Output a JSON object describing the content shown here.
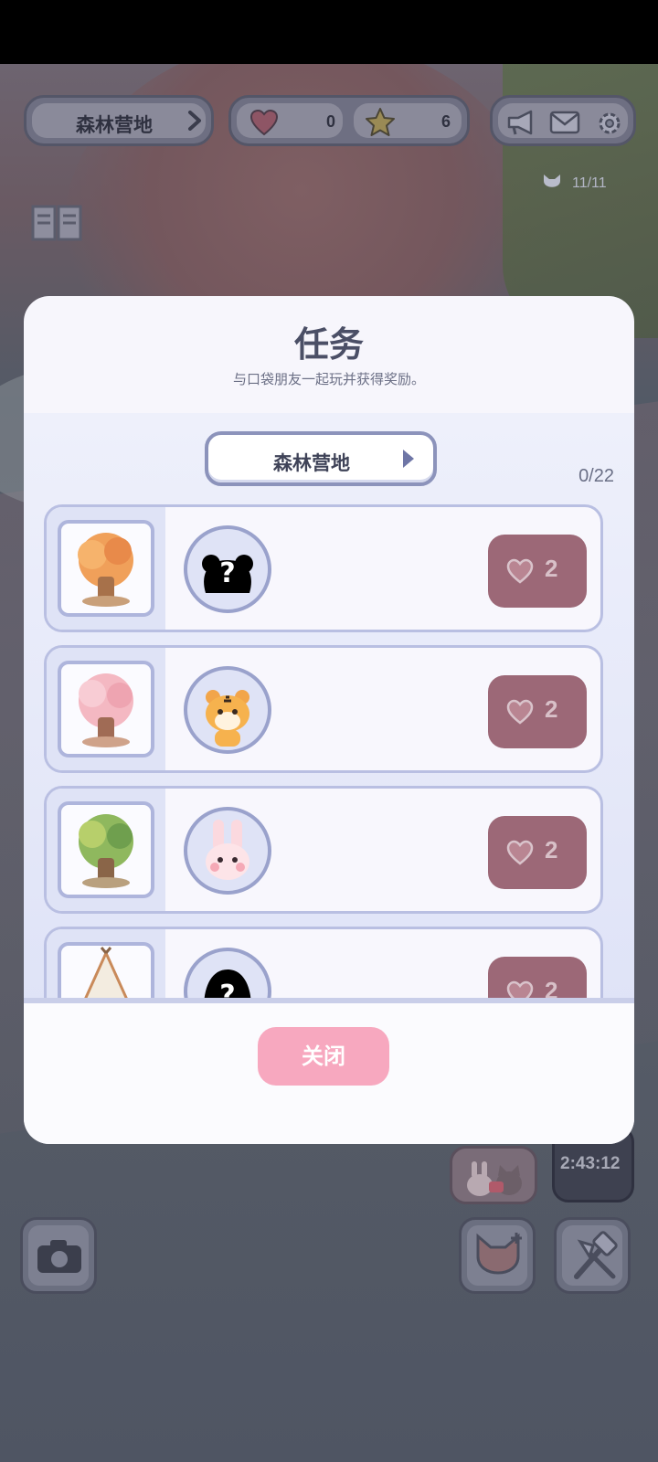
{
  "header": {
    "area_name": "森林营地",
    "hearts": "0",
    "stars": "6",
    "cat_capacity": "11/11"
  },
  "scene": {
    "timer": "2:43:12"
  },
  "dialog": {
    "title": "任务",
    "subtitle": "与口袋朋友一起玩并获得奖励。",
    "area_selector": "森林营地",
    "progress": "0/22",
    "tasks": [
      {
        "item": "autumn-tree",
        "friend": "unknown",
        "reward": "2"
      },
      {
        "item": "cherry-blossom-tree",
        "friend": "tiger",
        "reward": "2"
      },
      {
        "item": "green-tree",
        "friend": "bunny",
        "reward": "2"
      },
      {
        "item": "teepee-tent",
        "friend": "unknown",
        "reward": "2"
      }
    ],
    "close_label": "关闭"
  },
  "colors": {
    "reward_bg": "#9c6877",
    "close_button": "#f7a8bf",
    "card_border": "#b9bfe2",
    "title_text": "#4b4f66"
  }
}
